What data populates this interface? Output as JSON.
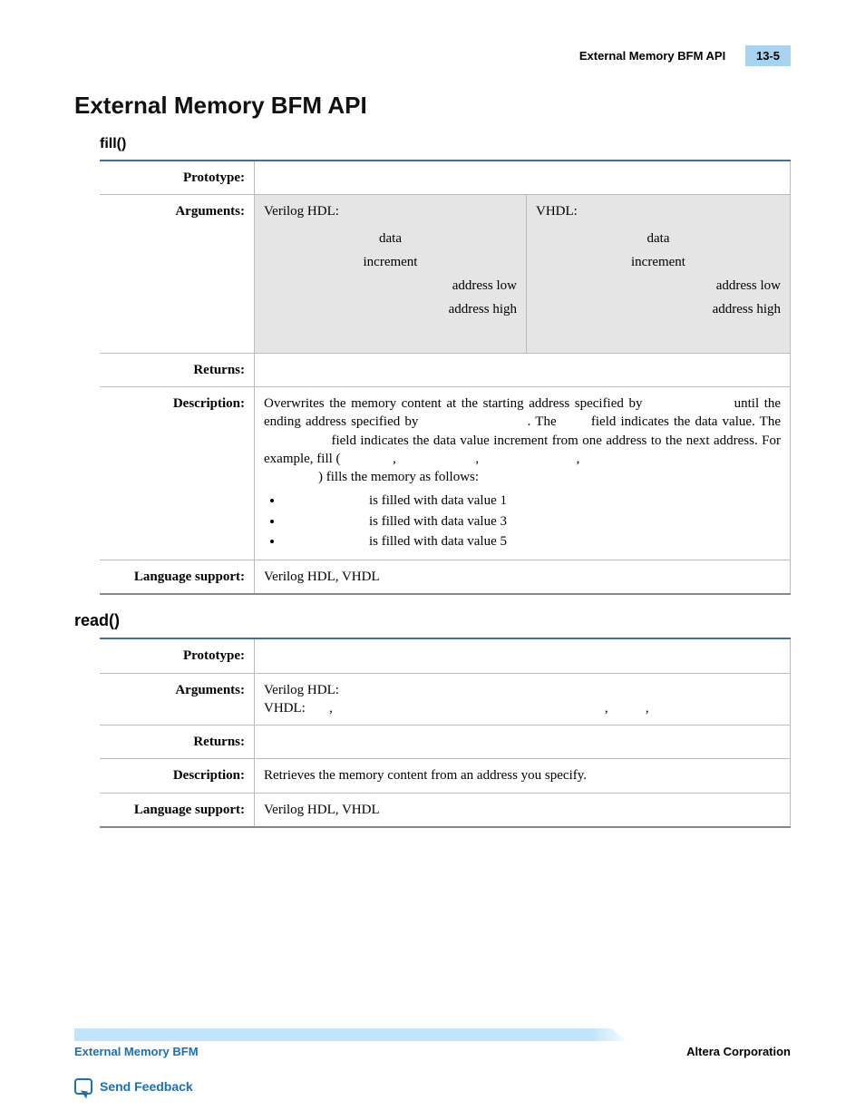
{
  "header": {
    "running_title": "External Memory BFM API",
    "page_tag": "13-5"
  },
  "h1": "External Memory BFM API",
  "fill": {
    "heading": "fill()",
    "rows": {
      "prototype_label": "Prototype:",
      "prototype_value": "",
      "arguments_label": "Arguments:",
      "verilog_label": "Verilog HDL:",
      "vhdl_label": "VHDL:",
      "args": {
        "a1": "data",
        "a2": "increment",
        "a3": "address low",
        "a4": "address high"
      },
      "returns_label": "Returns:",
      "returns_value": "",
      "description_label": "Description:",
      "desc_p1a": "Overwrites the memory content at the starting address specified by",
      "desc_p1b": "until",
      "desc_p2a": "the ending address specified by",
      "desc_p2b": ". The",
      "desc_p2c": "field indicates the data value.",
      "desc_p3a": "The",
      "desc_p3b": "field indicates the data value increment from one address to the next",
      "desc_p4a": "address. For example, fill (",
      "desc_p4b": ",",
      "desc_p4c": ",",
      "desc_p4d": ",",
      "desc_p5": ") fills the memory as follows:",
      "b1": "is filled with data value 1",
      "b2": "is filled with data value 3",
      "b3": "is filled with data value 5",
      "lang_label": "Language support:",
      "lang_value": "Verilog HDL, VHDL"
    }
  },
  "read": {
    "heading": "read()",
    "rows": {
      "prototype_label": "Prototype:",
      "prototype_value": "",
      "arguments_label": "Arguments:",
      "verilog_label": "Verilog HDL:",
      "vhdl_line": "VHDL:       ,                                                                                ,           ,",
      "returns_label": "Returns:",
      "returns_value": "",
      "description_label": "Description:",
      "description_value": "Retrieves the memory content from an address you specify.",
      "lang_label": "Language support:",
      "lang_value": "Verilog HDL, VHDL"
    }
  },
  "footer": {
    "left": "External Memory BFM",
    "right": "Altera Corporation",
    "feedback": "Send Feedback"
  }
}
